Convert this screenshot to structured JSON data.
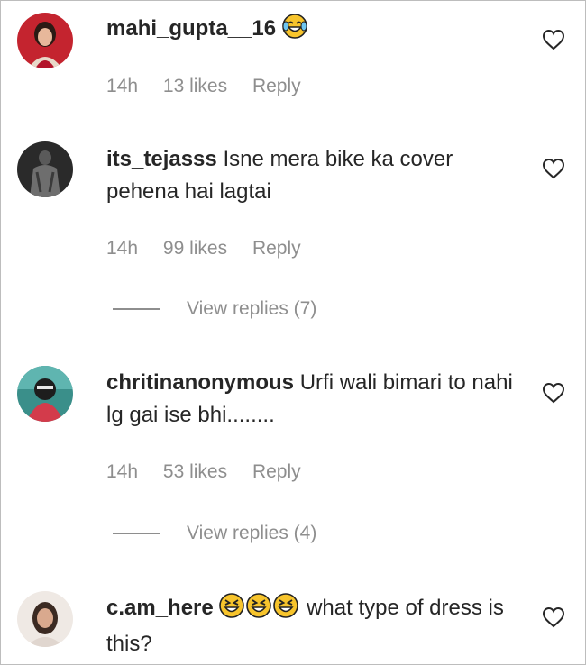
{
  "comments": [
    {
      "username": "mahi_gupta__16",
      "text": "",
      "emoji": [
        "face-with-tears-of-joy"
      ],
      "time": "14h",
      "likes": "13 likes",
      "reply": "Reply"
    },
    {
      "username": "its_tejasss",
      "text": "Isne mera bike ka cover pehena hai lagtai",
      "time": "14h",
      "likes": "99 likes",
      "reply": "Reply",
      "view_replies": "View replies (7)"
    },
    {
      "username": "chritinanonymous",
      "text": "Urfi wali bimari to nahi lg gai ise bhi........",
      "time": "14h",
      "likes": "53 likes",
      "reply": "Reply",
      "view_replies": "View replies (4)"
    },
    {
      "username": "c.am_here",
      "text": "what type of dress is this?",
      "emoji": [
        "grinning-squinting-face",
        "grinning-squinting-face",
        "grinning-squinting-face"
      ]
    }
  ],
  "colors": {
    "text": "#262626",
    "muted": "#8e8e8e",
    "emoji": "#f7c42c"
  }
}
